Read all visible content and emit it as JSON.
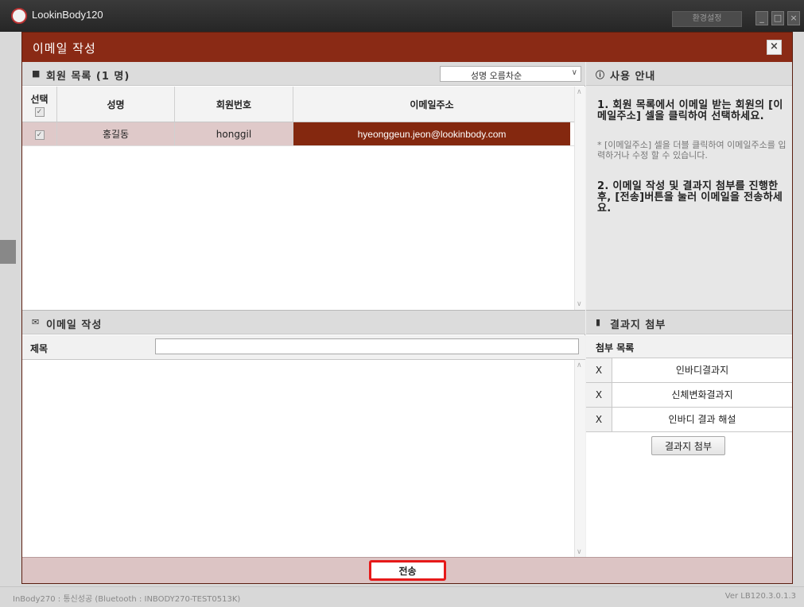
{
  "app": {
    "title": "LookinBody120",
    "settings_label": "환경설정",
    "status_left": "InBody270 : 통신성공 (Bluetooth : INBODY270-TEST0513K)",
    "status_right": "Ver LB120.3.0.1.3"
  },
  "dialog": {
    "title": "이메일 작성",
    "close_symbol": "×"
  },
  "member_list": {
    "header": "회원 목록 (1 명)",
    "sort": {
      "selected": "성명 오름차순"
    },
    "columns": {
      "select": "선택",
      "name": "성명",
      "member_no": "회원번호",
      "email": "이메일주소"
    },
    "rows": [
      {
        "checked": true,
        "name": "홍길동",
        "member_no": "honggil",
        "email": "hyeonggeun.jeon@lookinbody.com"
      }
    ]
  },
  "help": {
    "header": "사용 안내",
    "step1": "1. 회원 목록에서 이메일 받는 회원의 [이메일주소] 셀을 클릭하여 선택하세요.",
    "note": "* [이메일주소] 셀을 더블 클릭하여 이메일주소를 입력하거나 수정 할 수 있습니다.",
    "step2": "2. 이메일 작성 및 결과지 첨부를 진행한 후, [전송]버튼을 눌러 이메일을 전송하세요."
  },
  "compose": {
    "header": "이메일 작성",
    "subject_label": "제목",
    "subject_value": "",
    "body_value": ""
  },
  "attach": {
    "header": "결과지 첨부",
    "list_label": "첨부 목록",
    "remove_symbol": "X",
    "items": [
      {
        "name": "인바디결과지"
      },
      {
        "name": "신체변화결과지"
      },
      {
        "name": "인바디 결과 해설"
      }
    ],
    "button_label": "결과지 첨부"
  },
  "footer": {
    "send_label": "전송"
  },
  "colors": {
    "accent": "#8a2a15",
    "selected_cell": "#84280f",
    "row_highlight": "#dfc9c9",
    "send_border": "#e61919"
  }
}
